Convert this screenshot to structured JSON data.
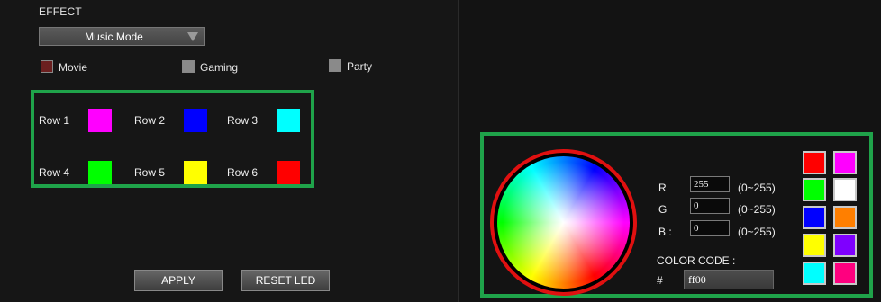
{
  "effect": {
    "label": "EFFECT",
    "selected": "Music Mode"
  },
  "modes": [
    {
      "label": "Movie",
      "checked": true,
      "box_color": "#6b1f1f"
    },
    {
      "label": "Gaming",
      "checked": false,
      "box_color": "#8a8a8a"
    },
    {
      "label": "Party",
      "checked": false,
      "box_color": "#8a8a8a"
    }
  ],
  "rows": [
    {
      "label": "Row 1",
      "color": "#ff00ff"
    },
    {
      "label": "Row 2",
      "color": "#0000ff"
    },
    {
      "label": "Row 3",
      "color": "#00ffff"
    },
    {
      "label": "Row 4",
      "color": "#00ff00"
    },
    {
      "label": "Row 5",
      "color": "#ffff00"
    },
    {
      "label": "Row 6",
      "color": "#ff0000"
    }
  ],
  "buttons": {
    "apply": "APPLY",
    "reset": "RESET LED"
  },
  "picker": {
    "r_label": "R",
    "g_label": "G",
    "b_label": "B :",
    "r_value": "255",
    "g_value": "0",
    "b_value": "0",
    "range": "(0~255)",
    "code_label": "COLOR CODE :",
    "hash": "#",
    "code_value": "ff00"
  },
  "presets": [
    "#ff0000",
    "#ff00ff",
    "#00ff00",
    "#ffffff",
    "#0000ff",
    "#ff7f00",
    "#ffff00",
    "#7f00ff",
    "#00ffff",
    "#ff007f"
  ],
  "accent_colors": {
    "highlight_frame": "#1fa34a",
    "wheel_ring": "#e01010"
  }
}
